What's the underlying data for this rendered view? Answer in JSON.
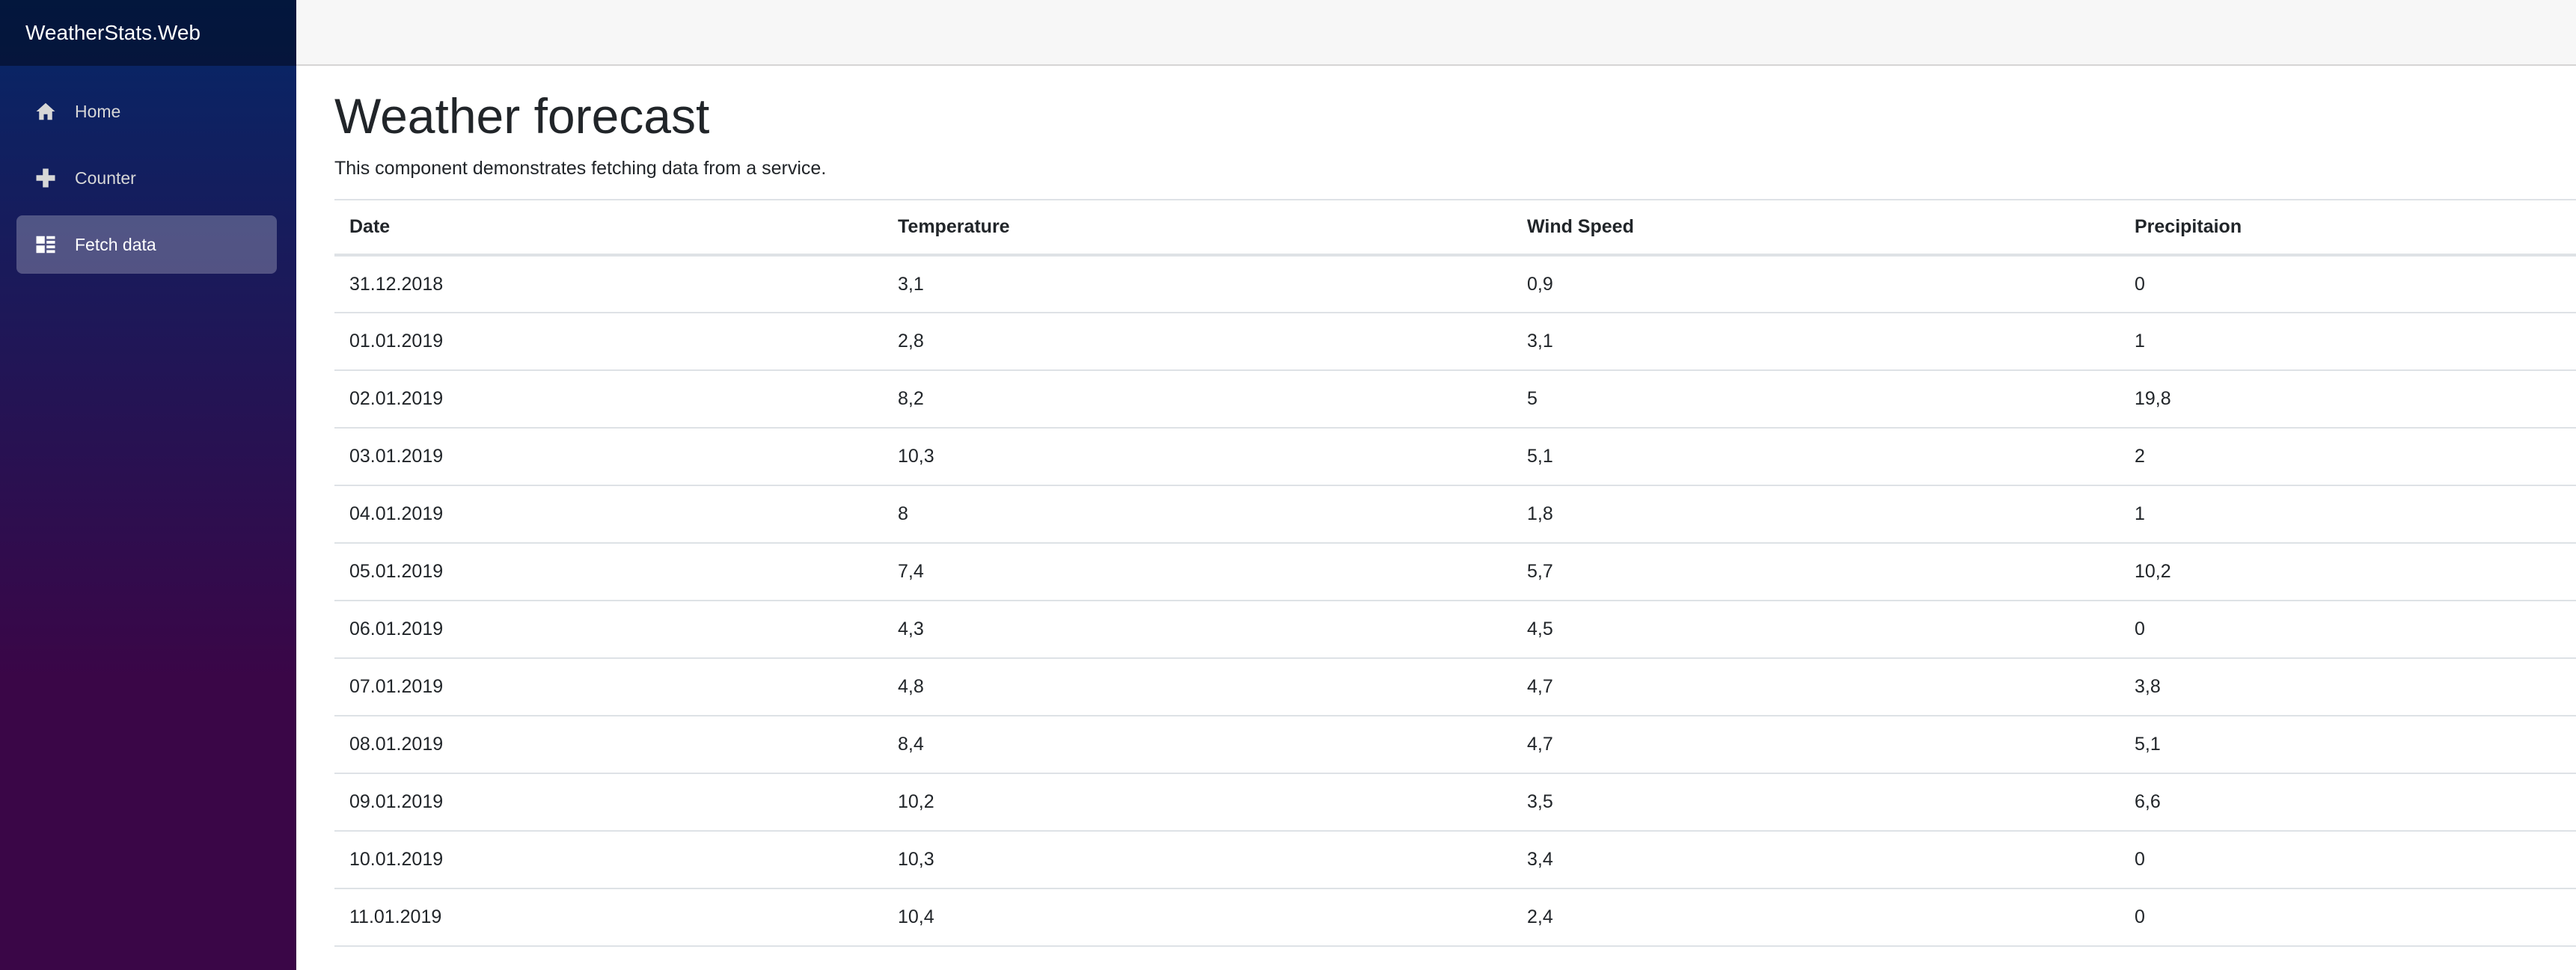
{
  "brand": "WeatherStats.Web",
  "nav": [
    {
      "label": "Home",
      "icon": "home-icon",
      "active": false
    },
    {
      "label": "Counter",
      "icon": "plus-icon",
      "active": false
    },
    {
      "label": "Fetch data",
      "icon": "list-icon",
      "active": true
    }
  ],
  "page": {
    "title": "Weather forecast",
    "description": "This component demonstrates fetching data from a service."
  },
  "table": {
    "headers": [
      "Date",
      "Temperature",
      "Wind Speed",
      "Precipitaion"
    ],
    "rows": [
      [
        "31.12.2018",
        "3,1",
        "0,9",
        "0"
      ],
      [
        "01.01.2019",
        "2,8",
        "3,1",
        "1"
      ],
      [
        "02.01.2019",
        "8,2",
        "5",
        "19,8"
      ],
      [
        "03.01.2019",
        "10,3",
        "5,1",
        "2"
      ],
      [
        "04.01.2019",
        "8",
        "1,8",
        "1"
      ],
      [
        "05.01.2019",
        "7,4",
        "5,7",
        "10,2"
      ],
      [
        "06.01.2019",
        "4,3",
        "4,5",
        "0"
      ],
      [
        "07.01.2019",
        "4,8",
        "4,7",
        "3,8"
      ],
      [
        "08.01.2019",
        "8,4",
        "4,7",
        "5,1"
      ],
      [
        "09.01.2019",
        "10,2",
        "3,5",
        "6,6"
      ],
      [
        "10.01.2019",
        "10,3",
        "3,4",
        "0"
      ],
      [
        "11.01.2019",
        "10,4",
        "2,4",
        "0"
      ]
    ]
  },
  "colors": {
    "sidebar_top": "#052767",
    "sidebar_bottom": "#3a0647",
    "top_row": "#f7f7f7"
  }
}
